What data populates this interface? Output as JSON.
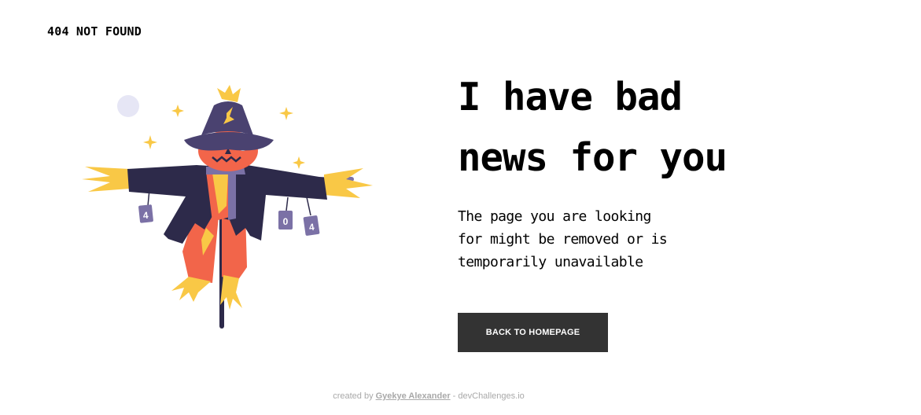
{
  "brand": {
    "label": "404 NOT FOUND"
  },
  "hero": {
    "headline": "I have bad\nnews for you",
    "message": "The page you are looking\nfor might be removed or is\ntemporarily unavailable",
    "cta_label": "BACK TO HOMEPAGE"
  },
  "illustration": {
    "can_labels": [
      "4",
      "0",
      "4"
    ]
  },
  "footer": {
    "prefix": "created by ",
    "author": "Gyekye Alexander",
    "suffix": " - devChallenges.io"
  },
  "colors": {
    "button_bg": "#333333",
    "hat": "#4a4270",
    "coat": "#2d2a4a",
    "face": "#f2654a",
    "straw": "#f9c846",
    "can": "#7b71a6",
    "moon": "#e6e6f5"
  }
}
